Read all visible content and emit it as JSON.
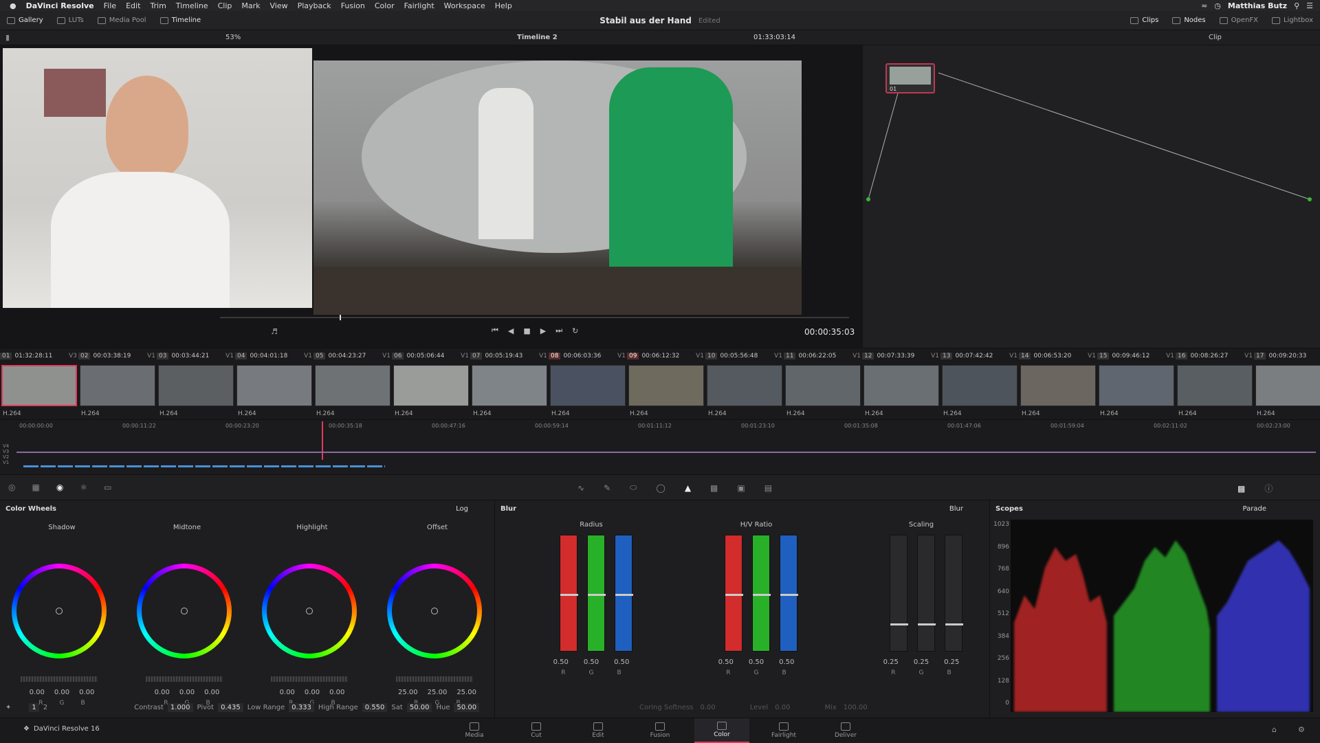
{
  "menubar": {
    "app": "DaVinci Resolve",
    "items": [
      "File",
      "Edit",
      "Trim",
      "Timeline",
      "Clip",
      "Mark",
      "View",
      "Playback",
      "Fusion",
      "Color",
      "Fairlight",
      "Workspace",
      "Help"
    ],
    "user": "Matthias Butz"
  },
  "toolbar": {
    "gallery": "Gallery",
    "luts": "LUTs",
    "media_pool": "Media Pool",
    "timeline": "Timeline",
    "title": "Stabil aus der Hand",
    "edited": "Edited",
    "clips": "Clips",
    "nodes": "Nodes",
    "openfx": "OpenFX",
    "lightbox": "Lightbox"
  },
  "viewerbar": {
    "zoom": "53%",
    "timeline_name": "Timeline 2",
    "timecode": "01:33:03:14",
    "mode": "Clip"
  },
  "transport": {
    "timecode": "00:00:35:03",
    "progress": 0.19
  },
  "node": {
    "label": "01"
  },
  "clips": [
    {
      "num": "01",
      "tc": "01:32:28:11",
      "track": "V3",
      "codec": "H.264",
      "color": "#8f918f"
    },
    {
      "num": "02",
      "tc": "00:03:38:19",
      "track": "V1",
      "codec": "H.264",
      "color": "#6a6e72"
    },
    {
      "num": "03",
      "tc": "00:03:44:21",
      "track": "V1",
      "codec": "H.264",
      "color": "#5c5f62"
    },
    {
      "num": "04",
      "tc": "00:04:01:18",
      "track": "V1",
      "codec": "H.264",
      "color": "#777b80"
    },
    {
      "num": "05",
      "tc": "00:04:23:27",
      "track": "V1",
      "codec": "H.264",
      "color": "#6e7275"
    },
    {
      "num": "06",
      "tc": "00:05:06:44",
      "track": "V1",
      "codec": "H.264",
      "color": "#9a9c9a"
    },
    {
      "num": "07",
      "tc": "00:05:19:43",
      "track": "V1",
      "codec": "H.264",
      "color": "#7f8488"
    },
    {
      "num": "08",
      "tc": "00:06:03:36",
      "track": "V1",
      "codec": "H.264",
      "color": "#4a5261"
    },
    {
      "num": "09",
      "tc": "00:06:12:32",
      "track": "V1",
      "codec": "H.264",
      "color": "#6f6a5e"
    },
    {
      "num": "10",
      "tc": "00:05:56:48",
      "track": "V1",
      "codec": "H.264",
      "color": "#555a60"
    },
    {
      "num": "11",
      "tc": "00:06:22:05",
      "track": "V1",
      "codec": "H.264",
      "color": "#61666b"
    },
    {
      "num": "12",
      "tc": "00:07:33:39",
      "track": "V1",
      "codec": "H.264",
      "color": "#6a6f74"
    },
    {
      "num": "13",
      "tc": "00:07:42:42",
      "track": "V1",
      "codec": "H.264",
      "color": "#4d545c"
    },
    {
      "num": "14",
      "tc": "00:06:53:20",
      "track": "V1",
      "codec": "H.264",
      "color": "#6b6660"
    },
    {
      "num": "15",
      "tc": "00:09:46:12",
      "track": "V1",
      "codec": "H.264",
      "color": "#5f6670"
    },
    {
      "num": "16",
      "tc": "00:08:26:27",
      "track": "V1",
      "codec": "H.264",
      "color": "#595e63"
    },
    {
      "num": "17",
      "tc": "00:09:20:33",
      "track": "V1",
      "codec": "H.264",
      "color": "#7a7e80"
    }
  ],
  "timeline": {
    "ruler": [
      "00:00:00:00",
      "00:00:11:22",
      "00:00:23:20",
      "00:00:35:18",
      "00:00:47:16",
      "00:00:59:14",
      "00:01:11:12",
      "00:01:23:10",
      "00:01:35:08",
      "00:01:47:06",
      "00:01:59:04",
      "00:02:11:02",
      "00:02:23:00"
    ],
    "tracks": [
      "V4",
      "V3",
      "V2",
      "V1"
    ]
  },
  "wheels": {
    "title": "Color Wheels",
    "mode": "Log",
    "items": [
      {
        "name": "Shadow",
        "values": [
          "0.00",
          "0.00",
          "0.00"
        ]
      },
      {
        "name": "Midtone",
        "values": [
          "0.00",
          "0.00",
          "0.00"
        ]
      },
      {
        "name": "Highlight",
        "values": [
          "0.00",
          "0.00",
          "0.00"
        ]
      },
      {
        "name": "Offset",
        "values": [
          "25.00",
          "25.00",
          "25.00"
        ]
      }
    ],
    "rgb": [
      "R",
      "G",
      "B"
    ],
    "footer": {
      "page_1": "1",
      "page_2": "2",
      "contrast_label": "Contrast",
      "contrast": "1.000",
      "pivot_label": "Pivot",
      "pivot": "0.435",
      "low_range_label": "Low Range",
      "low_range": "0.333",
      "high_range_label": "High Range",
      "high_range": "0.550",
      "sat_label": "Sat",
      "sat": "50.00",
      "hue_label": "Hue",
      "hue": "50.00"
    }
  },
  "blur": {
    "title": "Blur",
    "mode": "Blur",
    "groups": [
      {
        "name": "Radius",
        "values": [
          "0.50",
          "0.50",
          "0.50"
        ],
        "level": 0.5
      },
      {
        "name": "H/V Ratio",
        "values": [
          "0.50",
          "0.50",
          "0.50"
        ],
        "level": 0.5
      },
      {
        "name": "Scaling",
        "values": [
          "0.25",
          "0.25",
          "0.25"
        ],
        "level": 0.25
      }
    ],
    "footer": {
      "coring_label": "Coring Softness",
      "coring": "0.00",
      "level_label": "Level",
      "level": "0.00",
      "mix_label": "Mix",
      "mix": "100.00"
    }
  },
  "scopes": {
    "title": "Scopes",
    "mode": "Parade",
    "ylabels": [
      "1023",
      "896",
      "768",
      "640",
      "512",
      "384",
      "256",
      "128",
      "0"
    ]
  },
  "pages": [
    "Media",
    "Cut",
    "Edit",
    "Fusion",
    "Color",
    "Fairlight",
    "Deliver"
  ],
  "active_page": "Color",
  "footer": {
    "product": "DaVinci Resolve 16"
  },
  "colors": {
    "accent": "#e3395a",
    "red": "#d22c2c",
    "green": "#29b029",
    "blue": "#1f5fbf"
  }
}
